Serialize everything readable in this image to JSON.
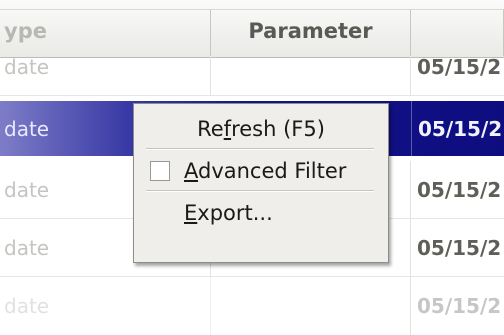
{
  "table": {
    "columns": [
      "ype",
      "Parameter",
      ""
    ],
    "rows": [
      {
        "type": "date",
        "parameter": "",
        "date": "05/15/2"
      },
      {
        "type": "date",
        "parameter": "",
        "date": "05/15/2",
        "selected": true
      },
      {
        "type": "date",
        "parameter": "",
        "date": "05/15/2"
      },
      {
        "type": "date",
        "parameter": "",
        "date": "05/15/2"
      },
      {
        "type": "date",
        "parameter": "",
        "date": "05/15/2"
      }
    ]
  },
  "context_menu": {
    "refresh": {
      "before": "Re",
      "mnemonic": "f",
      "after": "resh (F5)"
    },
    "advanced_filter": {
      "before": "",
      "mnemonic": "A",
      "after": "dvanced Filter",
      "checked": false
    },
    "export": {
      "before": "",
      "mnemonic": "E",
      "after": "xport..."
    }
  },
  "colors": {
    "selection": "#0d0d80",
    "header_bg": "#e9e9e6",
    "menu_bg": "#efeeea"
  }
}
